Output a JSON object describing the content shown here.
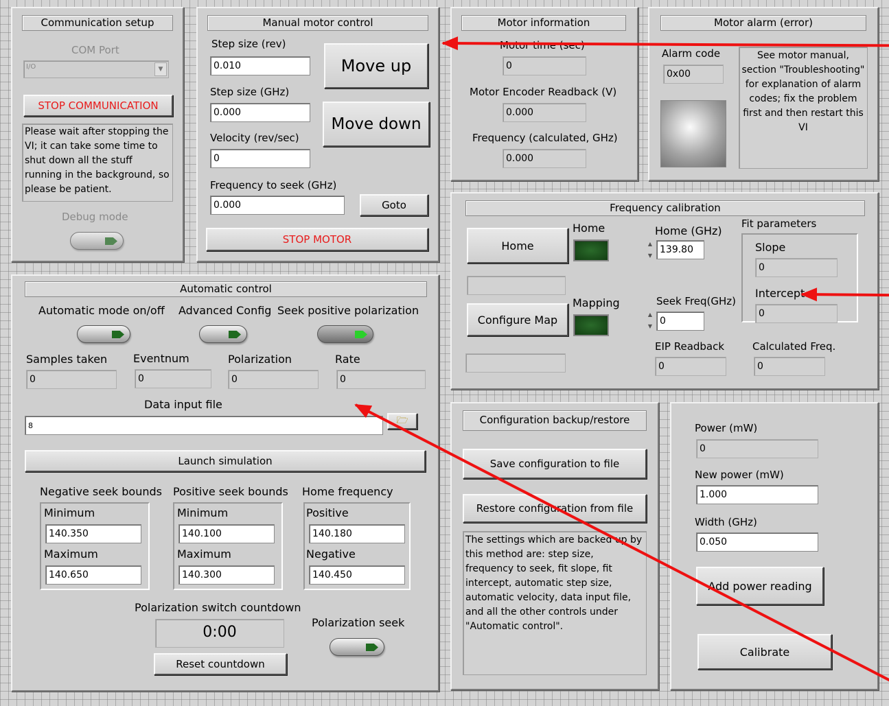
{
  "comm": {
    "title": "Communication setup",
    "com_label": "COM Port",
    "com_icon": "I/O",
    "stop_btn": "STOP COMMUNICATION",
    "note": "Please wait after stopping the VI; it can take some time to shut down all the stuff running in the background, so please be patient.",
    "debug": "Debug mode"
  },
  "manual": {
    "title": "Manual motor control",
    "step_rev_label": "Step size (rev)",
    "step_rev": "0.010",
    "step_ghz_label": "Step size (GHz)",
    "step_ghz": "0.000",
    "vel_label": "Velocity (rev/sec)",
    "vel": "0",
    "seek_label": "Frequency to seek (GHz)",
    "seek": "0.000",
    "move_up": "Move up",
    "move_down": "Move down",
    "goto": "Goto",
    "stop": "STOP MOTOR"
  },
  "info": {
    "title": "Motor information",
    "time_label": "Motor time (sec)",
    "time": "0",
    "enc_label": "Motor Encoder Readback (V)",
    "enc": "0.000",
    "freq_label": "Frequency (calculated, GHz)",
    "freq": "0.000"
  },
  "alarm": {
    "title": "Motor alarm (error)",
    "code_label": "Alarm code",
    "code": "0x00",
    "note": "See motor manual, section \"Troubleshooting\" for explanation of alarm codes; fix the problem first and then restart this VI"
  },
  "auto": {
    "title": "Automatic control",
    "mode": "Automatic mode on/off",
    "adv": "Advanced Config",
    "seekpol": "Seek positive polarization",
    "samples_label": "Samples taken",
    "samples": "0",
    "event_label": "Eventnum",
    "event": "0",
    "pol_label": "Polarization",
    "pol": "0",
    "rate_label": "Rate",
    "rate": "0",
    "file_label": "Data input file",
    "file_icon": "8",
    "launch": "Launch simulation",
    "neg_label": "Negative seek bounds",
    "pos_label": "Positive seek bounds",
    "home_label": "Home frequency",
    "min": "Minimum",
    "max": "Maximum",
    "neg_min": "140.350",
    "neg_max": "140.650",
    "pos_min": "140.100",
    "pos_max": "140.300",
    "positive": "Positive",
    "negative": "Negative",
    "home_pos": "140.180",
    "home_neg": "140.450",
    "countdown_label": "Polarization switch countdown",
    "countdown": "0:00",
    "reset": "Reset countdown",
    "polseek": "Polarization seek"
  },
  "cal": {
    "title": "Frequency calibration",
    "home_btn": "Home",
    "home_led": "Home",
    "home_ghz_label": "Home (GHz)",
    "home_ghz": "139.80",
    "fit": "Fit parameters",
    "slope_label": "Slope",
    "slope": "0",
    "intercept_label": "Intercept",
    "intercept": "0",
    "config_btn": "Configure Map",
    "mapping": "Mapping",
    "seek_label": "Seek Freq(GHz)",
    "seek": "0",
    "eip_label": "EIP Readback",
    "eip": "0",
    "calc_label": "Calculated Freq.",
    "calc": "0"
  },
  "backup": {
    "title": "Configuration backup/restore",
    "save": "Save configuration to file",
    "restore": "Restore configuration from file",
    "note": "The settings which are backed up by this method are: step size, frequency to seek, fit slope, fit intercept, automatic step size, automatic velocity, data input file, and all the other controls under \"Automatic control\"."
  },
  "power": {
    "power_label": "Power (mW)",
    "power": "0",
    "new_label": "New power (mW)",
    "new": "1.000",
    "width_label": "Width (GHz)",
    "width": "0.050",
    "add": "Add power reading",
    "calibrate": "Calibrate"
  },
  "colors": {
    "stop_text": "#e81b1b",
    "annotation_arrow": "#e11111",
    "led_off": "#1f5c1f"
  }
}
